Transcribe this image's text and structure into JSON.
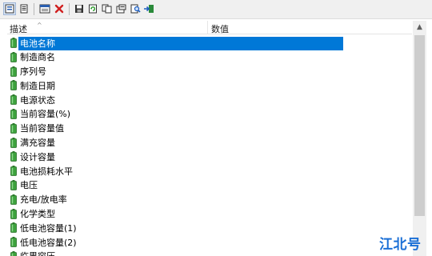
{
  "toolbar": {
    "buttons": [
      {
        "name": "view-icon-mode-icon"
      },
      {
        "name": "view-list-mode-icon"
      },
      {
        "name": "properties-window-icon"
      },
      {
        "name": "delete-x-icon"
      },
      {
        "name": "save-icon"
      },
      {
        "name": "refresh-icon"
      },
      {
        "name": "copy-icon"
      },
      {
        "name": "properties-icon"
      },
      {
        "name": "find-icon"
      },
      {
        "name": "exit-icon"
      }
    ]
  },
  "table": {
    "headers": {
      "description": "描述",
      "value": "数值"
    },
    "rows": [
      {
        "label": "电池名称",
        "selected": true
      },
      {
        "label": "制造商名"
      },
      {
        "label": "序列号"
      },
      {
        "label": "制造日期"
      },
      {
        "label": "电源状态"
      },
      {
        "label": "当前容量(%)"
      },
      {
        "label": "当前容量值"
      },
      {
        "label": "满充容量"
      },
      {
        "label": "设计容量"
      },
      {
        "label": "电池损耗水平"
      },
      {
        "label": "电压"
      },
      {
        "label": "充电/放电率"
      },
      {
        "label": "化学类型"
      },
      {
        "label": "低电池容量(1)"
      },
      {
        "label": "低电池容量(2)"
      },
      {
        "label": "临界容压"
      }
    ]
  },
  "watermark": {
    "text": "江北号"
  },
  "colors": {
    "selection": "#0078d7",
    "battery": "#3da23d",
    "watermark": "#1a6fd6"
  }
}
